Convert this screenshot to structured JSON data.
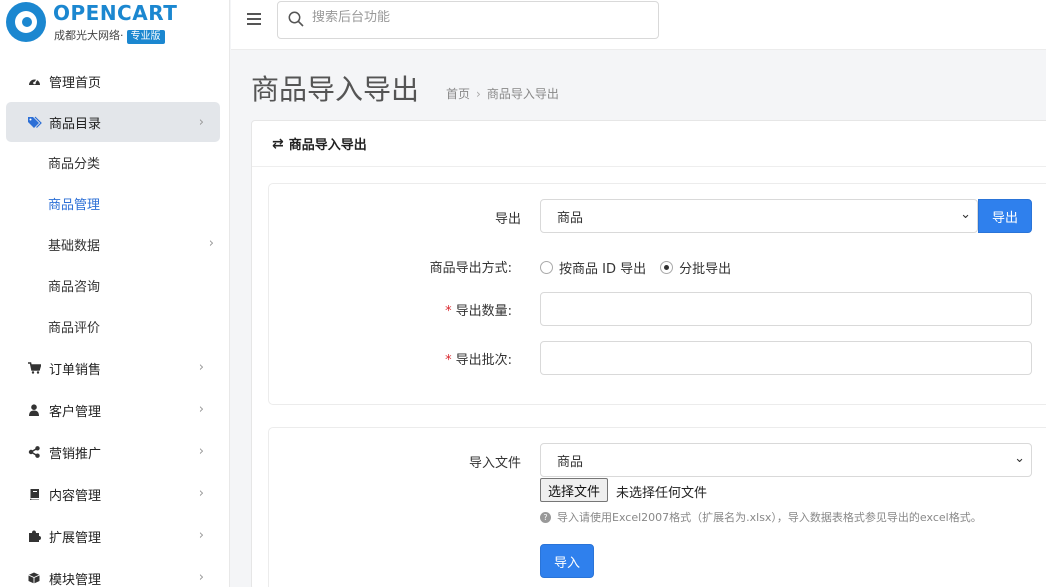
{
  "brand": {
    "name": "OPENCART",
    "subtitle": "成都光大网络·",
    "badge": "专业版"
  },
  "sidebar": {
    "items": [
      {
        "label": "管理首页",
        "icon": "dashboard-icon"
      },
      {
        "label": "商品目录",
        "icon": "tags-icon",
        "active": true
      },
      {
        "label": "订单销售",
        "icon": "cart-icon"
      },
      {
        "label": "客户管理",
        "icon": "user-icon"
      },
      {
        "label": "营销推广",
        "icon": "share-icon"
      },
      {
        "label": "内容管理",
        "icon": "book-icon"
      },
      {
        "label": "扩展管理",
        "icon": "puzzle-icon"
      },
      {
        "label": "模块管理",
        "icon": "cube-icon"
      }
    ],
    "subitems": [
      {
        "label": "商品分类"
      },
      {
        "label": "商品管理",
        "current": true
      },
      {
        "label": "基础数据"
      },
      {
        "label": "商品咨询"
      },
      {
        "label": "商品评价"
      }
    ]
  },
  "header": {
    "search_placeholder": "搜索后台功能"
  },
  "page": {
    "title": "商品导入导出",
    "breadcrumb": [
      "首页",
      "商品导入导出"
    ],
    "panel_title": "商品导入导出"
  },
  "export": {
    "label": "导出",
    "selected": "商品",
    "button": "导出",
    "method_label": "商品导出方式:",
    "method_options": [
      "按商品 ID 导出",
      "分批导出"
    ],
    "method_selected": "分批导出",
    "quantity_label": "导出数量:",
    "batch_label": "导出批次:",
    "quantity_value": "",
    "batch_value": ""
  },
  "import": {
    "label": "导入文件",
    "selected": "商品",
    "file_button": "选择文件",
    "file_status": "未选择任何文件",
    "help": "导入请使用Excel2007格式（扩展名为.xlsx），导入数据表格式参见导出的excel格式。",
    "button": "导入"
  },
  "colors": {
    "brand": "#1b87d0",
    "primary": "#2f80ed",
    "required": "#d9272e",
    "active_link": "#2c6fd6"
  }
}
